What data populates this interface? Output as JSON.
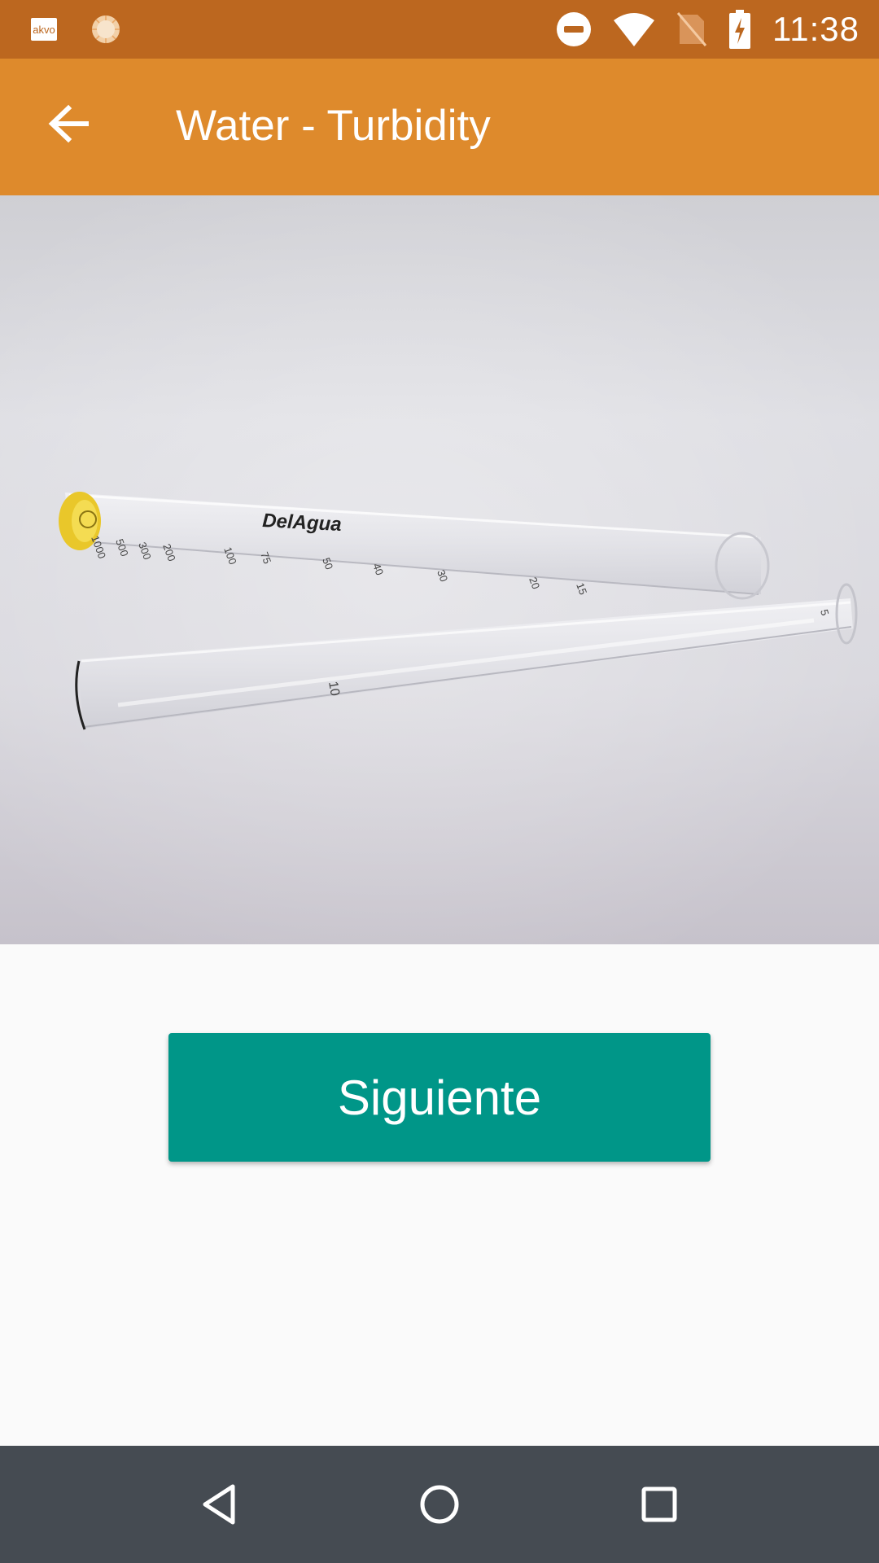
{
  "status_bar": {
    "app_badge": "akvo",
    "time": "11:38",
    "icons": [
      "akvo-icon",
      "sun-icon",
      "do-not-disturb-icon",
      "wifi-icon",
      "no-sim-icon",
      "battery-charging-icon"
    ]
  },
  "app_bar": {
    "title": "Water - Turbidity",
    "back_icon": "arrow-back-icon"
  },
  "image": {
    "brand_text": "DelAgua",
    "tube_markings": [
      "1000",
      "500",
      "300",
      "200",
      "100",
      "75",
      "50",
      "40",
      "30",
      "20",
      "15",
      "10",
      "5"
    ]
  },
  "actions": {
    "next_label": "Siguiente"
  },
  "nav_bar": {
    "icons": [
      "back-triangle-icon",
      "home-circle-icon",
      "recents-square-icon"
    ]
  },
  "colors": {
    "status_bar": "#bc671f",
    "app_bar": "#de8a2c",
    "button": "#009688",
    "nav_bar": "#454b52",
    "background": "#fafafa"
  }
}
